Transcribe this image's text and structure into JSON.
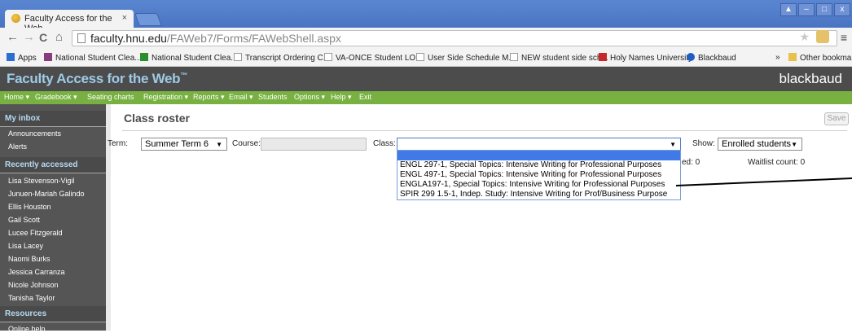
{
  "browser": {
    "tab_title": "Faculty Access for the Web",
    "tab_close": "×",
    "url_host": "faculty.hnu.edu",
    "url_path": "/FAWeb7/Forms/FAWebShell.aspx",
    "back_icon": "←",
    "forward_icon": "→",
    "reload_icon": "C",
    "home_icon": "⌂",
    "star_icon": "★",
    "menu_icon": "≡",
    "window_controls": [
      "▲",
      "–",
      "□",
      "x"
    ],
    "bookmarks": [
      {
        "label": "Apps",
        "icon": "apps-grid-icon",
        "color": "#2c6fd1"
      },
      {
        "label": "National Student Clea...",
        "icon": "nsc-icon",
        "color": "#8a3b7d"
      },
      {
        "label": "National Student Clea...",
        "icon": "green-arrow-icon",
        "color": "#2a8f2a"
      },
      {
        "label": "Transcript Ordering C...",
        "icon": "page-icon",
        "color": "#9a9a9a"
      },
      {
        "label": "VA-ONCE Student LO...",
        "icon": "page-icon",
        "color": "#9a9a9a"
      },
      {
        "label": "User Side Schedule M...",
        "icon": "ap-icon",
        "color": "#9a9a9a"
      },
      {
        "label": "NEW student side sch...",
        "icon": "page-icon",
        "color": "#9a9a9a"
      },
      {
        "label": "Holy Names University",
        "icon": "hnu-icon",
        "color": "#c7282a"
      },
      {
        "label": "Blackbaud",
        "icon": "blackbaud-icon",
        "color": "#1f5cc4"
      }
    ],
    "more_bookmarks": "»",
    "other_bookmarks": "Other bookmarks"
  },
  "app": {
    "title": "Faculty Access for the Web",
    "title_mark": "™",
    "brand": "blackbaud"
  },
  "menu": [
    "Home ▾",
    "Gradebook ▾",
    "Seating charts",
    "Registration ▾",
    "Reports ▾",
    "Email ▾",
    "Students",
    "Options ▾",
    "Help ▾",
    "Exit"
  ],
  "sidebar": {
    "inbox_heading": "My inbox",
    "inbox_items": [
      "Announcements",
      "Alerts"
    ],
    "recent_heading": "Recently accessed",
    "recent_items": [
      "Lisa Stevenson-Vigil",
      "Junuen-Mariah Galindo",
      "Ellis Houston",
      "Gail Scott",
      "Lucee Fitzgerald",
      "Lisa Lacey",
      "Naomi Burks",
      "Jessica Carranza",
      "Nicole Johnson",
      "Tanisha Taylor"
    ],
    "resources_heading": "Resources",
    "resources_items": [
      "Online help"
    ]
  },
  "main": {
    "page_title": "Class roster",
    "save_label": "Save",
    "term_label": "Term:",
    "term_value": "Summer Term 6",
    "course_label": "Course:",
    "course_value": "",
    "class_label": "Class:",
    "class_value": "",
    "class_options": [
      "ENGL 297-1, Special Topics: Intensive Writing for Professional Purposes",
      "ENGL 497-1, Special Topics: Intensive Writing for Professional Purposes",
      "ENGLA197-1, Special Topics: Intensive Writing for Professional Purposes",
      "SPIR 299 1.5-1, Indep. Study: Intensive Writing for Prof/Business Purpose"
    ],
    "show_label": "Show:",
    "show_value": "Enrolled students",
    "enrolled_fragment": "ed: 0",
    "waitlist_count": "Waitlist count: 0"
  },
  "colors": {
    "tab_strip": "#4a74c2",
    "app_header": "#4c4c4c",
    "app_title": "#9fcbe6",
    "menu_bar": "#78b142",
    "sidebar": "#555555",
    "sidebar_heading": "#b6daf2",
    "dropdown_highlight": "#3f7ae8"
  }
}
